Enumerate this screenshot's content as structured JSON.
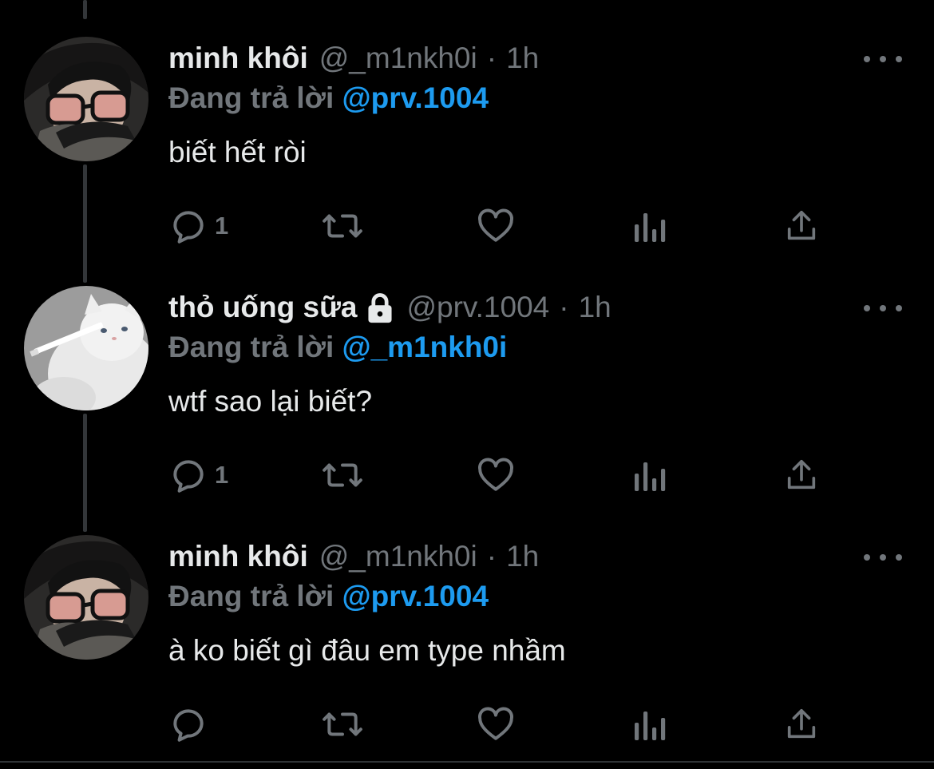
{
  "theme": {
    "background": "#000000",
    "text_primary": "#e7e9ea",
    "text_secondary": "#71767b",
    "accent": "#1d9bf0",
    "thread_line": "#333639"
  },
  "tweets": [
    {
      "display_name": "minh khôi",
      "locked": false,
      "handle": "@_m1nkh0i",
      "separator": "·",
      "time": "1h",
      "reply_prefix": "Đang trả lời",
      "reply_to": "@prv.1004",
      "text": "biết hết ròi",
      "reply_count": "1",
      "avatar_icon": "person-glasses-avatar"
    },
    {
      "display_name": "thỏ uống sữa",
      "locked": true,
      "handle": "@prv.1004",
      "separator": "·",
      "time": "1h",
      "reply_prefix": "Đang trả lời",
      "reply_to": "@_m1nkh0i",
      "text": "wtf sao lại biết?",
      "reply_count": "1",
      "avatar_icon": "white-cat-avatar"
    },
    {
      "display_name": "minh khôi",
      "locked": false,
      "handle": "@_m1nkh0i",
      "separator": "·",
      "time": "1h",
      "reply_prefix": "Đang trả lời",
      "reply_to": "@prv.1004",
      "text": "à ko biết gì đâu em type nhầm",
      "reply_count": "",
      "avatar_icon": "person-glasses-avatar"
    }
  ],
  "action_icons": [
    "reply-icon",
    "retweet-icon",
    "like-icon",
    "analytics-icon",
    "share-icon"
  ],
  "more_icon": "more-options-icon",
  "lock_icon": "lock-icon"
}
